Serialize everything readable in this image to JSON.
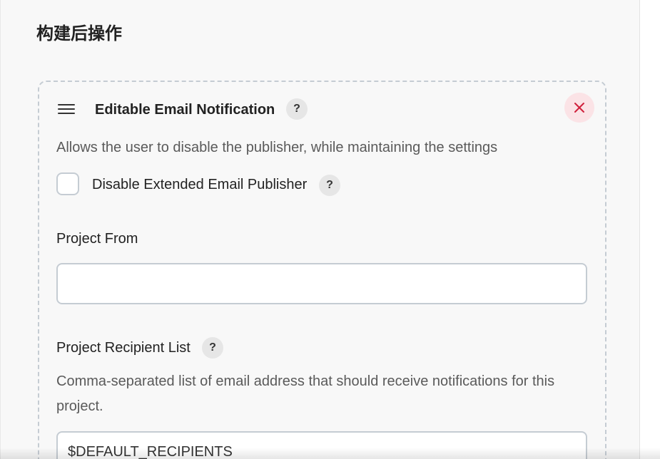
{
  "section": {
    "title": "构建后操作"
  },
  "card": {
    "title": "Editable Email Notification",
    "help_label": "?",
    "close_label": "×",
    "description": "Allows the user to disable the publisher, while maintaining the settings",
    "disable_checkbox": {
      "label": "Disable Extended Email Publisher",
      "checked": false,
      "help_label": "?"
    },
    "project_from": {
      "label": "Project From",
      "value": ""
    },
    "recipient_list": {
      "label": "Project Recipient List",
      "help_label": "?",
      "description": "Comma-separated list of email address that should receive notifications for this project.",
      "value": "$DEFAULT_RECIPIENTS"
    }
  },
  "colors": {
    "close_icon": "#d0213d",
    "close_bg": "#fbe3e6",
    "border": "#c5ccd3",
    "panel_bg": "#f8f8f8"
  },
  "icons": {
    "drag": "drag-handle-icon",
    "close": "close-icon",
    "help": "help-icon"
  }
}
